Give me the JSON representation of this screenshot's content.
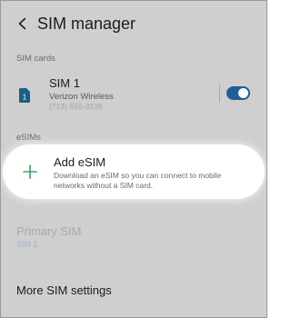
{
  "header": {
    "title": "SIM manager",
    "back_icon": "chevron-left-icon"
  },
  "sections": {
    "sim_cards_label": "SIM cards",
    "esims_label": "eSIMs"
  },
  "sim": {
    "name": "SIM 1",
    "carrier": "Verizon Wireless",
    "number_obscured": "(713) 555-0136",
    "enabled": true,
    "icon": "sim-card-icon",
    "icon_color": "#1a5f8a",
    "toggle_color": "#1f5f96"
  },
  "add_esim": {
    "title": "Add eSIM",
    "description": "Download an eSIM so you can connect to mobile networks without a SIM card.",
    "icon": "plus-icon",
    "icon_color": "#3aa765"
  },
  "primary_sim": {
    "title": "Primary SIM",
    "value": "SIM 1"
  },
  "more_settings": {
    "label": "More SIM settings"
  }
}
